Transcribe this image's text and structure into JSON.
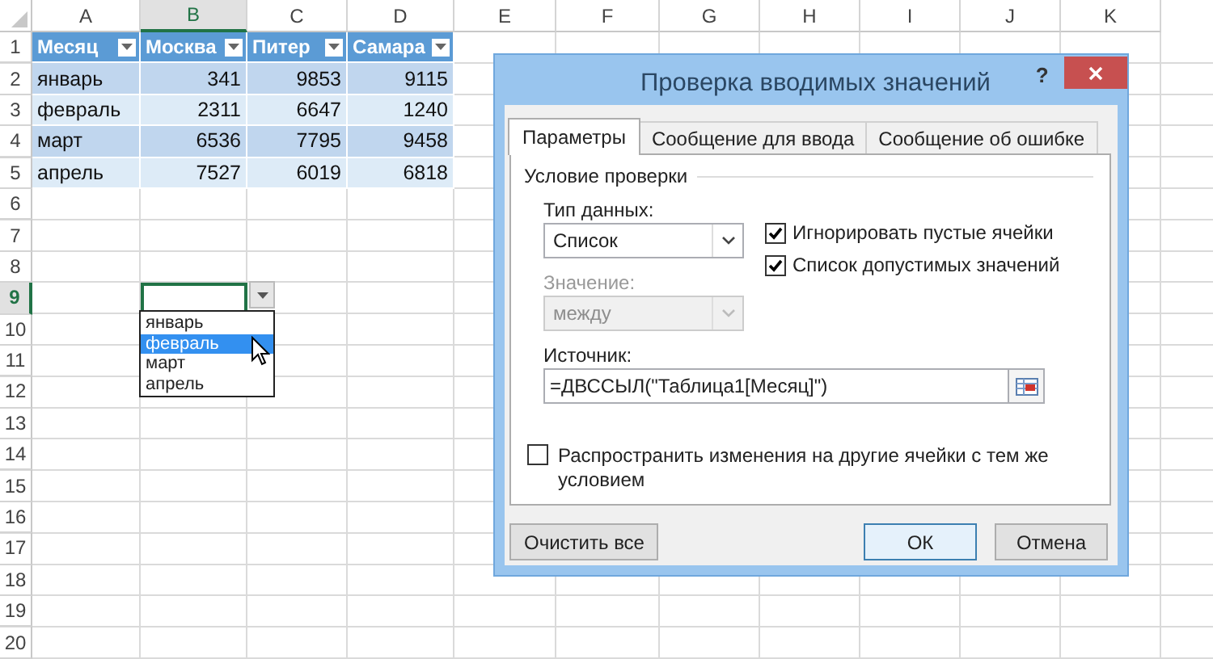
{
  "sheet": {
    "columns": [
      {
        "label": "A",
        "selected": false
      },
      {
        "label": "B",
        "selected": true
      },
      {
        "label": "C",
        "selected": false
      },
      {
        "label": "D",
        "selected": false
      },
      {
        "label": "E",
        "selected": false
      },
      {
        "label": "F",
        "selected": false
      },
      {
        "label": "G",
        "selected": false
      },
      {
        "label": "H",
        "selected": false
      },
      {
        "label": "I",
        "selected": false
      },
      {
        "label": "J",
        "selected": false
      },
      {
        "label": "K",
        "selected": false
      }
    ],
    "rows": [
      {
        "label": "1",
        "selected": false
      },
      {
        "label": "2",
        "selected": false
      },
      {
        "label": "3",
        "selected": false
      },
      {
        "label": "4",
        "selected": false
      },
      {
        "label": "5",
        "selected": false
      },
      {
        "label": "6",
        "selected": false
      },
      {
        "label": "7",
        "selected": false
      },
      {
        "label": "8",
        "selected": false
      },
      {
        "label": "9",
        "selected": true
      },
      {
        "label": "10",
        "selected": false
      },
      {
        "label": "11",
        "selected": false
      },
      {
        "label": "12",
        "selected": false
      },
      {
        "label": "13",
        "selected": false
      },
      {
        "label": "14",
        "selected": false
      },
      {
        "label": "15",
        "selected": false
      },
      {
        "label": "16",
        "selected": false
      },
      {
        "label": "17",
        "selected": false
      },
      {
        "label": "18",
        "selected": false
      },
      {
        "label": "19",
        "selected": false
      },
      {
        "label": "20",
        "selected": false
      }
    ]
  },
  "table": {
    "headers": [
      "Месяц",
      "Москва",
      "Питер",
      "Самара"
    ],
    "rows": [
      [
        "январь",
        "341",
        "9853",
        "9115"
      ],
      [
        "февраль",
        "2311",
        "6647",
        "1240"
      ],
      [
        "март",
        "6536",
        "7795",
        "9458"
      ],
      [
        "апрель",
        "7527",
        "6019",
        "6818"
      ]
    ]
  },
  "dropdown": {
    "items": [
      {
        "label": "январь",
        "selected": false
      },
      {
        "label": "февраль",
        "selected": true
      },
      {
        "label": "март",
        "selected": false
      },
      {
        "label": "апрель",
        "selected": false
      }
    ]
  },
  "dialog": {
    "title": "Проверка вводимых значений",
    "help": "?",
    "tabs": [
      {
        "label": "Параметры",
        "selected": true
      },
      {
        "label": "Сообщение для ввода",
        "selected": false
      },
      {
        "label": "Сообщение об ошибке",
        "selected": false
      }
    ],
    "section": "Условие проверки",
    "data_type": {
      "label": "Тип данных:",
      "value": "Список",
      "disabled": false
    },
    "value_field": {
      "label": "Значение:",
      "value": "между",
      "disabled": true
    },
    "checkboxes": [
      {
        "label": "Игнорировать пустые ячейки",
        "checked": true
      },
      {
        "label": "Список допустимых значений",
        "checked": true
      }
    ],
    "source": {
      "label": "Источник:",
      "value": "=ДВССЫЛ(\"Таблица1[Месяц]\")"
    },
    "propagate": {
      "label": "Распространить изменения на другие ячейки с тем же условием",
      "checked": false
    },
    "buttons": [
      {
        "label": "Очистить все",
        "default": false
      },
      {
        "label": "ОК",
        "default": true
      },
      {
        "label": "Отмена",
        "default": false
      }
    ]
  }
}
